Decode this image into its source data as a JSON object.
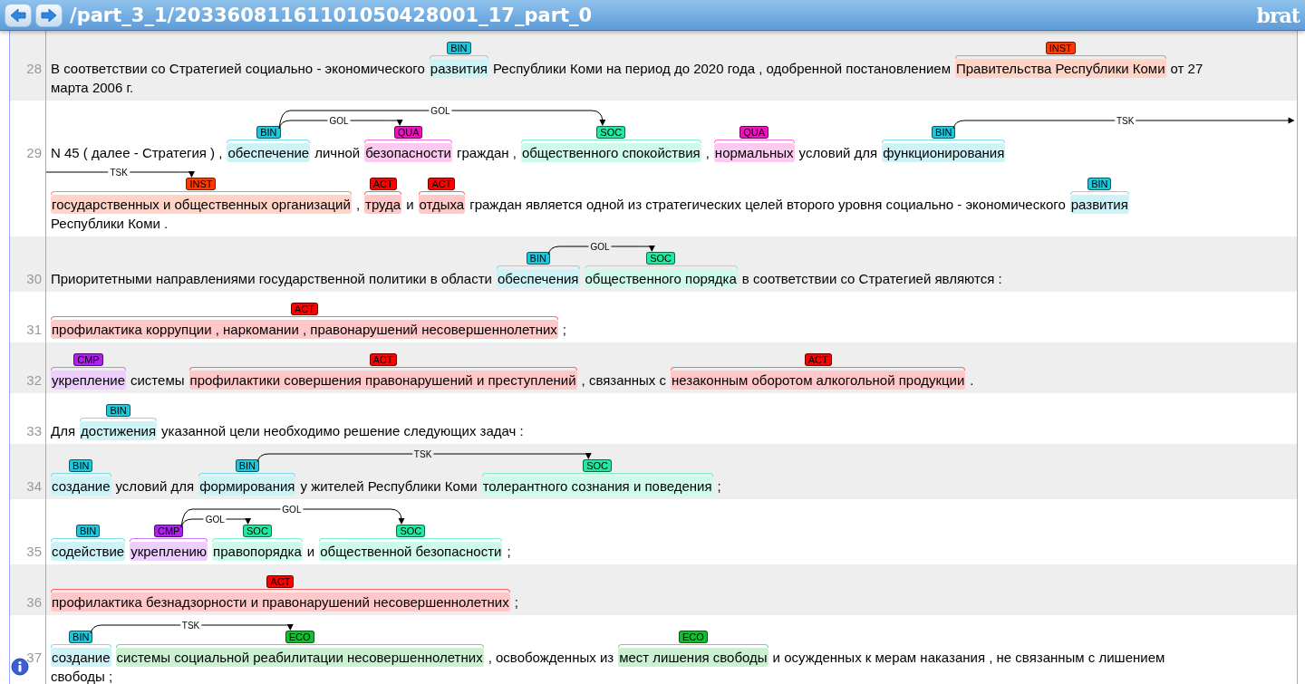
{
  "header": {
    "title": "/part_3_1/20336081161101050428001_17_part_0",
    "logo": "brat"
  },
  "sentences": [
    {
      "number": "28",
      "lines": [
        [
          {
            "kind": "text",
            "text": "В соответствии со Стратегией социально - экономического"
          },
          {
            "kind": "entity",
            "text": "развития",
            "label": "BIN",
            "color": "#1ec8dc"
          },
          {
            "kind": "text",
            "text": "Республики Коми на период до 2020 года , одобренной постановлением"
          },
          {
            "kind": "entity",
            "text": "Правительства Республики Коми",
            "label": "INST",
            "color": "#ff3a00"
          },
          {
            "kind": "text",
            "text": "от 27"
          }
        ],
        [
          {
            "kind": "text",
            "text": "марта 2006 г."
          }
        ]
      ]
    },
    {
      "number": "29",
      "lines": [
        [
          {
            "kind": "text",
            "text": "N 45 ( далее - Стратегия ) ,"
          },
          {
            "kind": "entity",
            "text": "обеспечение",
            "label": "BIN",
            "color": "#1ec8dc",
            "arcs_out": [
              {
                "label": "GOL"
              },
              {
                "label": "GOL"
              }
            ]
          },
          {
            "kind": "text",
            "text": "личной"
          },
          {
            "kind": "entity",
            "text": "безопасности",
            "label": "QUA",
            "color": "#f010c0",
            "arcs_in": [
              {
                "kind": "arrowhead"
              }
            ]
          },
          {
            "kind": "text",
            "text": "граждан ,"
          },
          {
            "kind": "entity",
            "text": "общественного спокойствия",
            "label": "SOC",
            "color": "#22e8a0",
            "arcs_in": [
              {
                "kind": "arrowhead"
              }
            ]
          },
          {
            "kind": "text",
            "text": ","
          },
          {
            "kind": "entity",
            "text": "нормальных",
            "label": "QUA",
            "color": "#f010c0"
          },
          {
            "kind": "text",
            "text": "условий для"
          },
          {
            "kind": "entity",
            "text": "функционирования",
            "label": "BIN",
            "color": "#1ec8dc",
            "arcs_out": [
              {
                "label": "TSK"
              }
            ]
          }
        ],
        [
          {
            "kind": "entity",
            "text": "государственных и общественных организаций",
            "label": "INST",
            "color": "#ff3a00",
            "arcs_in": [
              {
                "kind": "arrowhead",
                "label": "TSK"
              }
            ]
          },
          {
            "kind": "text",
            "text": ","
          },
          {
            "kind": "entity",
            "text": "труда",
            "label": "ACT",
            "color": "#ff0000"
          },
          {
            "kind": "text",
            "text": "и"
          },
          {
            "kind": "entity",
            "text": "отдыха",
            "label": "ACT",
            "color": "#ff0000"
          },
          {
            "kind": "text",
            "text": "граждан является одной из стратегических целей второго уровня социально - экономического"
          },
          {
            "kind": "entity",
            "text": "развития",
            "label": "BIN",
            "color": "#1ec8dc"
          }
        ],
        [
          {
            "kind": "text",
            "text": "Республики Коми ."
          }
        ]
      ]
    },
    {
      "number": "30",
      "lines": [
        [
          {
            "kind": "text",
            "text": "Приоритетными направлениями государственной политики в области"
          },
          {
            "kind": "entity",
            "text": "обеспечения",
            "label": "BIN",
            "color": "#1ec8dc",
            "arcs_out": [
              {
                "label": "GOL"
              }
            ]
          },
          {
            "kind": "entity",
            "text": "общественного порядка",
            "label": "SOC",
            "color": "#22e8a0",
            "arcs_in": [
              {
                "kind": "arrowhead"
              }
            ]
          },
          {
            "kind": "text",
            "text": "в соответствии со Стратегией являются :"
          }
        ]
      ]
    },
    {
      "number": "31",
      "lines": [
        [
          {
            "kind": "entity",
            "text": "профилактика коррупции , наркомании , правонарушений несовершеннолетних",
            "label": "ACT",
            "color": "#ff0000"
          },
          {
            "kind": "text",
            "text": ";"
          }
        ]
      ]
    },
    {
      "number": "32",
      "lines": [
        [
          {
            "kind": "entity",
            "text": "укрепление",
            "label": "CMP",
            "color": "#b020f0"
          },
          {
            "kind": "text",
            "text": "системы"
          },
          {
            "kind": "entity",
            "text": "профилактики совершения правонарушений и преступлений",
            "label": "ACT",
            "color": "#ff0000"
          },
          {
            "kind": "text",
            "text": ", связанных с"
          },
          {
            "kind": "entity",
            "text": "незаконным оборотом алкогольной продукции",
            "label": "ACT",
            "color": "#ff0000"
          },
          {
            "kind": "text",
            "text": "."
          }
        ]
      ]
    },
    {
      "number": "33",
      "lines": [
        [
          {
            "kind": "text",
            "text": "Для"
          },
          {
            "kind": "entity",
            "text": "достижения",
            "label": "BIN",
            "color": "#1ec8dc"
          },
          {
            "kind": "text",
            "text": "указанной цели необходимо решение следующих задач :"
          }
        ]
      ]
    },
    {
      "number": "34",
      "lines": [
        [
          {
            "kind": "entity",
            "text": "создание",
            "label": "BIN",
            "color": "#1ec8dc"
          },
          {
            "kind": "text",
            "text": "условий для"
          },
          {
            "kind": "entity",
            "text": "формирования",
            "label": "BIN",
            "color": "#1ec8dc",
            "arcs_out": [
              {
                "label": "TSK"
              }
            ]
          },
          {
            "kind": "text",
            "text": "у жителей Республики Коми"
          },
          {
            "kind": "entity",
            "text": "толерантного сознания и поведения",
            "label": "SOC",
            "color": "#22e8a0",
            "arcs_in": [
              {
                "kind": "arrowhead"
              }
            ]
          },
          {
            "kind": "text",
            "text": ";"
          }
        ]
      ]
    },
    {
      "number": "35",
      "lines": [
        [
          {
            "kind": "entity",
            "text": "содействие",
            "label": "BIN",
            "color": "#1ec8dc"
          },
          {
            "kind": "entity",
            "text": "укреплению",
            "label": "CMP",
            "color": "#b020f0",
            "arcs_out": [
              {
                "label": "GOL"
              },
              {
                "label": "GOL"
              }
            ]
          },
          {
            "kind": "entity",
            "text": "правопорядка",
            "label": "SOC",
            "color": "#22e8a0",
            "arcs_in": [
              {
                "kind": "arrowhead"
              }
            ]
          },
          {
            "kind": "text",
            "text": "и"
          },
          {
            "kind": "entity",
            "text": "общественной безопасности",
            "label": "SOC",
            "color": "#22e8a0",
            "arcs_in": [
              {
                "kind": "arrowhead"
              }
            ]
          },
          {
            "kind": "text",
            "text": ";"
          }
        ]
      ]
    },
    {
      "number": "36",
      "lines": [
        [
          {
            "kind": "entity",
            "text": "профилактика безнадзорности и правонарушений несовершеннолетних",
            "label": "ACT",
            "color": "#ff0000"
          },
          {
            "kind": "text",
            "text": ";"
          }
        ]
      ]
    },
    {
      "number": "37",
      "lines": [
        [
          {
            "kind": "entity",
            "text": "создание",
            "label": "BIN",
            "color": "#1ec8dc",
            "arcs_out": [
              {
                "label": "TSK"
              }
            ]
          },
          {
            "kind": "entity",
            "text": "системы социальной реабилитации несовершеннолетних",
            "label": "ECO",
            "color": "#10c030",
            "arcs_in": [
              {
                "kind": "arrowhead"
              }
            ]
          },
          {
            "kind": "text",
            "text": ", освобожденных из"
          },
          {
            "kind": "entity",
            "text": "мест лишения свободы",
            "label": "ECO",
            "color": "#10c030"
          },
          {
            "kind": "text",
            "text": "и осужденных к мерам наказания , не связанным с лишением"
          }
        ],
        [
          {
            "kind": "text",
            "text": "свободы ;"
          }
        ]
      ]
    }
  ]
}
